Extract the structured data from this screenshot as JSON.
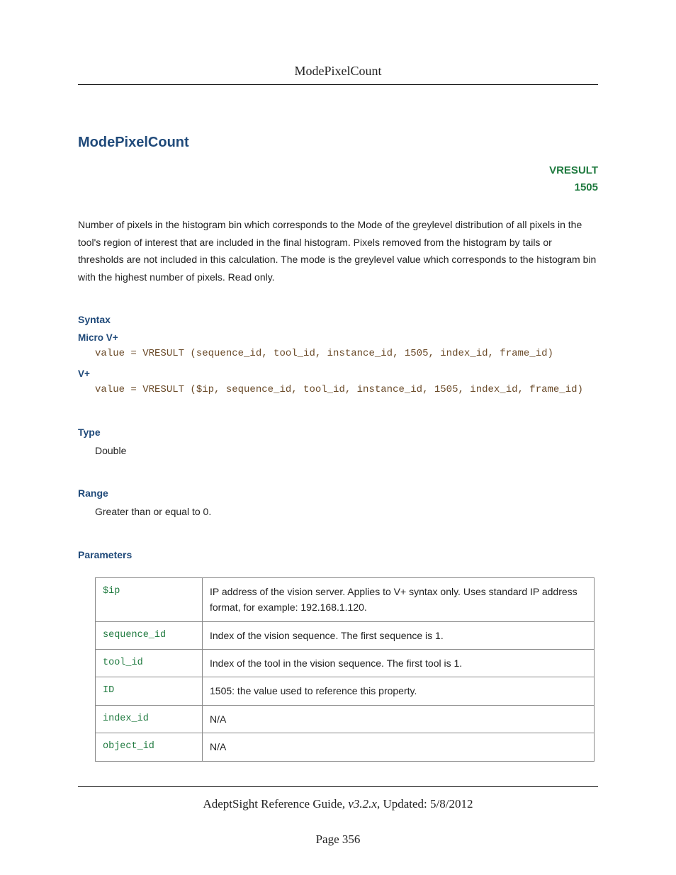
{
  "running_head": "ModePixelCount",
  "title": "ModePixelCount",
  "tag": {
    "label": "VRESULT",
    "code": "1505"
  },
  "description": "Number of pixels in the histogram bin which corresponds to the Mode of the greylevel distribution of all pixels in the tool's region of interest that are included in the final histogram. Pixels removed from the histogram by tails or thresholds are not included in this calculation. The mode is the greylevel value which corresponds to the histogram bin with the highest number of pixels. Read only.",
  "sections": {
    "syntax": {
      "heading": "Syntax",
      "micro_label": "Micro V+",
      "micro_code": "value = VRESULT (sequence_id, tool_id, instance_id, 1505, index_id, frame_id)",
      "vplus_label": "V+",
      "vplus_code": "value = VRESULT ($ip, sequence_id, tool_id, instance_id, 1505, index_id, frame_id)"
    },
    "type": {
      "heading": "Type",
      "value": "Double"
    },
    "range": {
      "heading": "Range",
      "value": "Greater than or equal to 0."
    },
    "parameters": {
      "heading": "Parameters",
      "rows": [
        {
          "name": "$ip",
          "desc": "IP address of the vision server. Applies to V+ syntax only. Uses standard IP address format, for example: 192.168.1.120."
        },
        {
          "name": "sequence_id",
          "desc": "Index of the vision sequence. The first sequence is 1."
        },
        {
          "name": "tool_id",
          "desc": "Index of the tool in the vision sequence. The first tool is 1."
        },
        {
          "name": "ID",
          "desc": "1505: the value used to reference this property."
        },
        {
          "name": "index_id",
          "desc": "N/A"
        },
        {
          "name": "object_id",
          "desc": "N/A"
        }
      ]
    }
  },
  "footer": {
    "guide": "AdeptSight Reference Guide",
    "version": "v3.2.x",
    "updated_label": "Updated:",
    "updated_date": "5/8/2012",
    "page_label": "Page",
    "page_num": "356"
  }
}
